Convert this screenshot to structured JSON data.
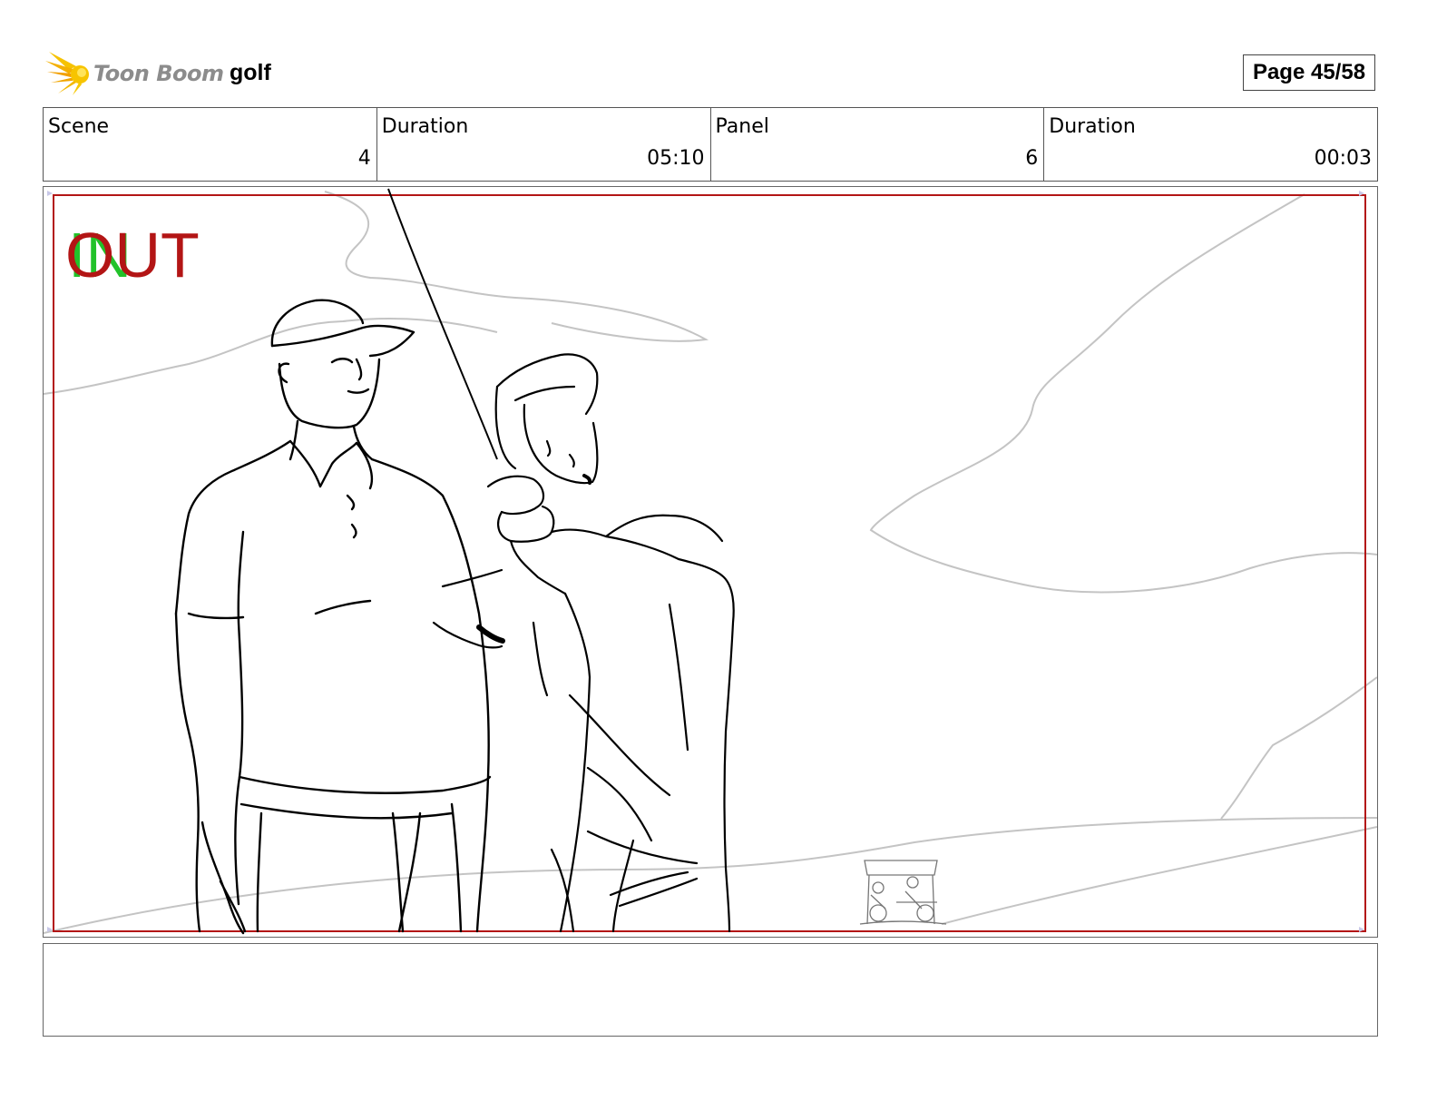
{
  "header": {
    "brand": "Toon Boom",
    "project_title": "golf",
    "page_label": "Page 45/58"
  },
  "info": {
    "scene_label": "Scene",
    "scene_value": "4",
    "scene_duration_label": "Duration",
    "scene_duration_value": "05:10",
    "panel_label": "Panel",
    "panel_value": "6",
    "panel_duration_label": "Duration",
    "panel_duration_value": "00:03"
  },
  "panel_image": {
    "marker_in": "IN",
    "marker_out": "OUT",
    "in_color": "#22c22a",
    "out_color": "#b31515",
    "frame_color": "#b31515"
  },
  "notes": {
    "text": ""
  }
}
